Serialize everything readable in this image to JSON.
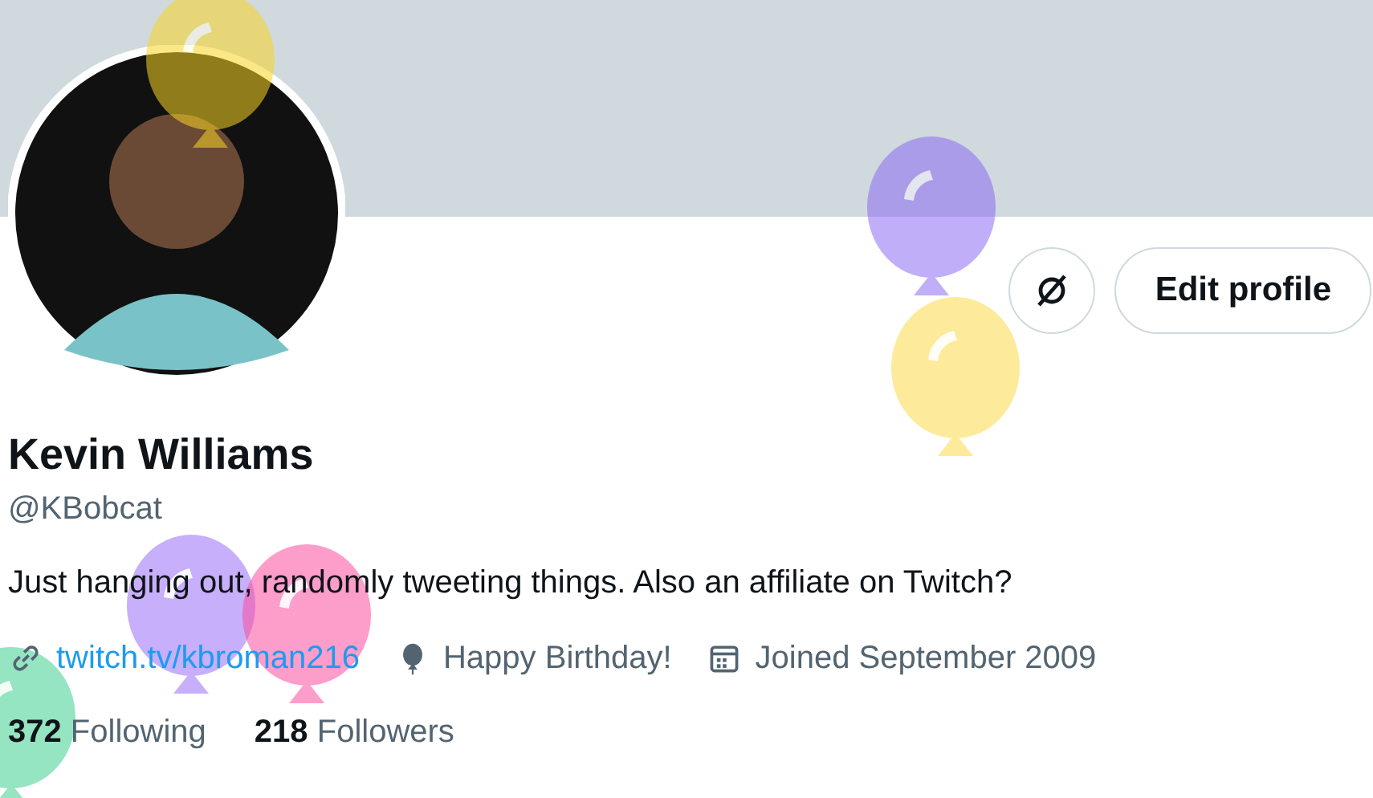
{
  "profile": {
    "name": "Kevin Williams",
    "handle": "@KBobcat",
    "bio": "Just hanging out, randomly tweeting things. Also an affiliate on Twitch?"
  },
  "buttons": [
    {
      "kind": "icon"
    },
    {
      "kind": "text",
      "label": "Edit profile"
    }
  ],
  "meta": [
    {
      "kind": "link",
      "text": "twitch.tv/kbroman216"
    },
    {
      "kind": "birthday",
      "text": "Happy Birthday!"
    },
    {
      "kind": "joined",
      "text": "Joined September 2009"
    }
  ],
  "stats": [
    {
      "count": "372",
      "label": "Following"
    },
    {
      "count": "218",
      "label": "Followers"
    }
  ]
}
